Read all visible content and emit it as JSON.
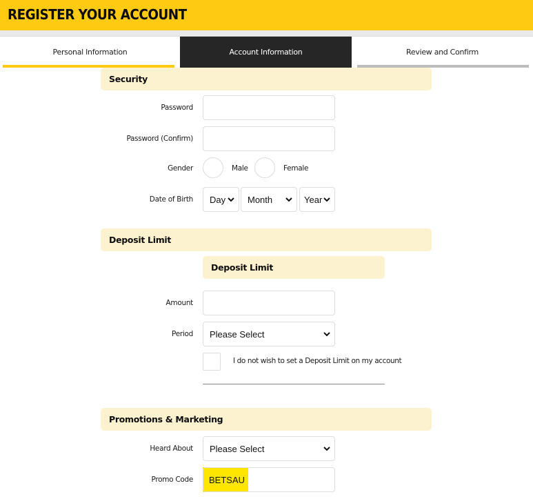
{
  "header": {
    "title": "REGISTER YOUR ACCOUNT",
    "accent_color": "#fecb12"
  },
  "tabs": [
    {
      "label": "Personal Information",
      "state": "completed"
    },
    {
      "label": "Account Information",
      "state": "active"
    },
    {
      "label": "Review and Confirm",
      "state": "pending"
    }
  ],
  "security": {
    "title": "Security",
    "password": {
      "label": "Password",
      "value": ""
    },
    "password_confirm": {
      "label": "Password (Confirm)",
      "value": ""
    },
    "gender": {
      "label": "Gender",
      "options": [
        "Male",
        "Female"
      ],
      "selected": null
    },
    "dob": {
      "label": "Date of Birth",
      "day": "Day",
      "month": "Month",
      "year": "Year"
    }
  },
  "deposit": {
    "title": "Deposit Limit",
    "subtitle": "Deposit Limit",
    "amount": {
      "label": "Amount",
      "value": ""
    },
    "period": {
      "label": "Period",
      "value": "Please Select"
    },
    "no_limit": {
      "label": "I do not wish to set a Deposit Limit on my account",
      "checked": false
    }
  },
  "promotions": {
    "title": "Promotions & Marketing",
    "heard_about": {
      "label": "Heard About",
      "value": "Please Select"
    },
    "promo_code": {
      "label": "Promo Code",
      "value": "BETSAU"
    }
  }
}
